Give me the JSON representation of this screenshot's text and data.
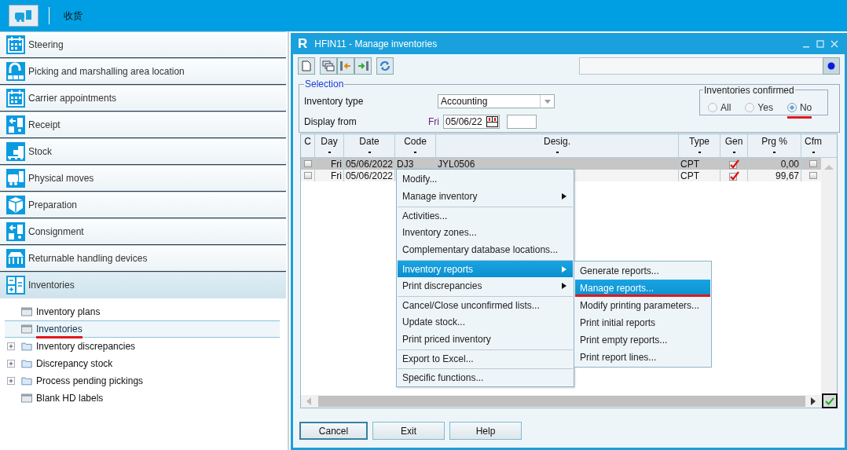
{
  "topbar": {
    "title": "收货"
  },
  "modules": [
    {
      "label": "Steering",
      "kind": "calendar",
      "selected": false
    },
    {
      "label": "Picking and marshalling area location",
      "kind": "hook",
      "selected": false
    },
    {
      "label": "Carrier appointments",
      "kind": "calendar",
      "selected": false
    },
    {
      "label": "Receipt",
      "kind": "arrow",
      "selected": false
    },
    {
      "label": "Stock",
      "kind": "boxes",
      "selected": false
    },
    {
      "label": "Physical moves",
      "kind": "truck",
      "selected": false
    },
    {
      "label": "Preparation",
      "kind": "shield",
      "selected": false
    },
    {
      "label": "Consignment",
      "kind": "arrow",
      "selected": false
    },
    {
      "label": "Returnable handling devices",
      "kind": "rack",
      "selected": false
    },
    {
      "label": "Inventories",
      "kind": "calc",
      "selected": true
    }
  ],
  "tree": [
    {
      "label": "Inventory plans",
      "kind": "leaf",
      "expandable": false,
      "selected": false,
      "underlined": false
    },
    {
      "label": "Inventories",
      "kind": "leaf",
      "expandable": false,
      "selected": true,
      "underlined": true
    },
    {
      "label": "Inventory discrepancies",
      "kind": "folder",
      "expandable": true,
      "selected": false,
      "underlined": false
    },
    {
      "label": "Discrepancy stock",
      "kind": "folder",
      "expandable": true,
      "selected": false,
      "underlined": false
    },
    {
      "label": "Process pending pickings",
      "kind": "folder",
      "expandable": true,
      "selected": false,
      "underlined": false
    },
    {
      "label": "Blank HD labels",
      "kind": "leaf",
      "expandable": false,
      "selected": false,
      "underlined": false
    }
  ],
  "dialog": {
    "logo": "R",
    "title": "HFIN11 - Manage inventories",
    "selection": {
      "legend": "Selection",
      "type_label": "Inventory type",
      "type_value": "Accounting",
      "from_label": "Display from",
      "from_day": "Fri",
      "from_date": "05/06/22"
    },
    "confirmed": {
      "legend": "Inventories confirmed",
      "options": [
        {
          "label": "All",
          "selected": false,
          "underlined": false
        },
        {
          "label": "Yes",
          "selected": false,
          "underlined": false
        },
        {
          "label": "No",
          "selected": true,
          "underlined": true
        }
      ]
    },
    "table": {
      "columns": [
        "C",
        "Day",
        "Date",
        "Code",
        "Desig.",
        "Type",
        "Gen",
        "Prg %",
        "Cfm"
      ],
      "rows": [
        {
          "selected": true,
          "checked": false,
          "day": "Fri",
          "date": "05/06/2022",
          "code": "DJ3",
          "desig": "JYL0506",
          "type": "CPT",
          "gen": true,
          "prg": "0,00",
          "cfm": false
        },
        {
          "selected": false,
          "checked": false,
          "day": "Fri",
          "date": "05/06/2022",
          "type": "CPT",
          "gen": true,
          "prg": "99,67",
          "cfm": false
        }
      ]
    },
    "buttons": [
      {
        "label": "Cancel",
        "default": true
      },
      {
        "label": "Exit",
        "default": false
      },
      {
        "label": "Help",
        "default": false
      }
    ]
  },
  "context_menu": [
    {
      "label": "Modify...",
      "submenu": false,
      "highlighted": false,
      "separator_before": false
    },
    {
      "label": "Manage inventory",
      "submenu": true,
      "highlighted": false,
      "separator_before": false
    },
    {
      "label": "Activities...",
      "submenu": false,
      "highlighted": false,
      "separator_before": true
    },
    {
      "label": "Inventory zones...",
      "submenu": false,
      "highlighted": false,
      "separator_before": false
    },
    {
      "label": "Complementary database locations...",
      "submenu": false,
      "highlighted": false,
      "separator_before": false
    },
    {
      "label": "Inventory reports",
      "submenu": true,
      "highlighted": true,
      "separator_before": true
    },
    {
      "label": "Print discrepancies",
      "submenu": true,
      "highlighted": false,
      "separator_before": false
    },
    {
      "label": "Cancel/Close unconfirmed lists...",
      "submenu": false,
      "highlighted": false,
      "separator_before": true
    },
    {
      "label": "Update stock...",
      "submenu": false,
      "highlighted": false,
      "separator_before": false
    },
    {
      "label": "Print priced inventory",
      "submenu": false,
      "highlighted": false,
      "separator_before": false
    },
    {
      "label": "Export to Excel...",
      "submenu": false,
      "highlighted": false,
      "separator_before": true
    },
    {
      "label": "Specific functions...",
      "submenu": false,
      "highlighted": false,
      "separator_before": true
    }
  ],
  "submenu": [
    {
      "label": "Generate reports...",
      "highlighted": false,
      "underlined": false
    },
    {
      "label": "Manage reports...",
      "highlighted": true,
      "underlined": true
    },
    {
      "label": "Modify printing parameters...",
      "highlighted": false,
      "underlined": false
    },
    {
      "label": "Print initial reports",
      "highlighted": false,
      "underlined": false
    },
    {
      "label": "Print empty reports...",
      "highlighted": false,
      "underlined": false
    },
    {
      "label": "Print report lines...",
      "highlighted": false,
      "underlined": false
    }
  ]
}
